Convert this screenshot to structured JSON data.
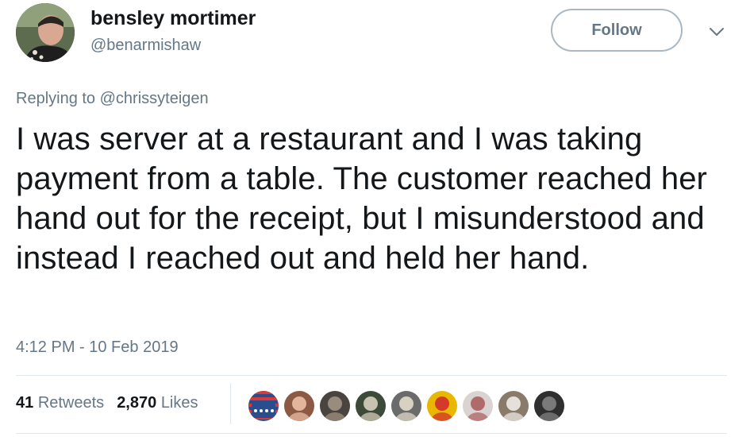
{
  "user": {
    "display_name": "bensley mortimer",
    "handle": "@benarmishaw",
    "avatar_icon": "profile-photo-icon"
  },
  "follow_label": "Follow",
  "reply_prefix": "Replying to ",
  "reply_handle": "@chrissyteigen",
  "tweet_text": "I was server at a restaurant and I was taking payment from a table. The customer reached her hand out for the receipt, but I misunderstood and instead I reached out and held her hand.",
  "timestamp": "4:12 PM - 10 Feb 2019",
  "stats": {
    "retweets_count": "41",
    "retweets_label": "Retweets",
    "likes_count": "2,870",
    "likes_label": "Likes"
  },
  "colors": {
    "text_primary": "#14171a",
    "text_secondary": "#657786",
    "border": "#e1e8ed",
    "button_border": "#aab8c2"
  },
  "likers": [
    {
      "name": "liker-avatar-flag",
      "bg": "#2a4d8f",
      "fg": "#d63a3a"
    },
    {
      "name": "liker-avatar-2",
      "bg": "#8c5a44",
      "fg": "#e3b59a"
    },
    {
      "name": "liker-avatar-3",
      "bg": "#4a4440",
      "fg": "#9a8c7c"
    },
    {
      "name": "liker-avatar-4",
      "bg": "#3d4a3a",
      "fg": "#c9c2b0"
    },
    {
      "name": "liker-avatar-5",
      "bg": "#6b6b6b",
      "fg": "#d8d0c0"
    },
    {
      "name": "liker-avatar-6",
      "bg": "#e8b800",
      "fg": "#d43a2a"
    },
    {
      "name": "liker-avatar-7",
      "bg": "#d9d4d2",
      "fg": "#b06a6a"
    },
    {
      "name": "liker-avatar-8",
      "bg": "#8a7a6a",
      "fg": "#e6e0da"
    },
    {
      "name": "liker-avatar-9",
      "bg": "#2f2f2f",
      "fg": "#7a7a7a"
    }
  ]
}
